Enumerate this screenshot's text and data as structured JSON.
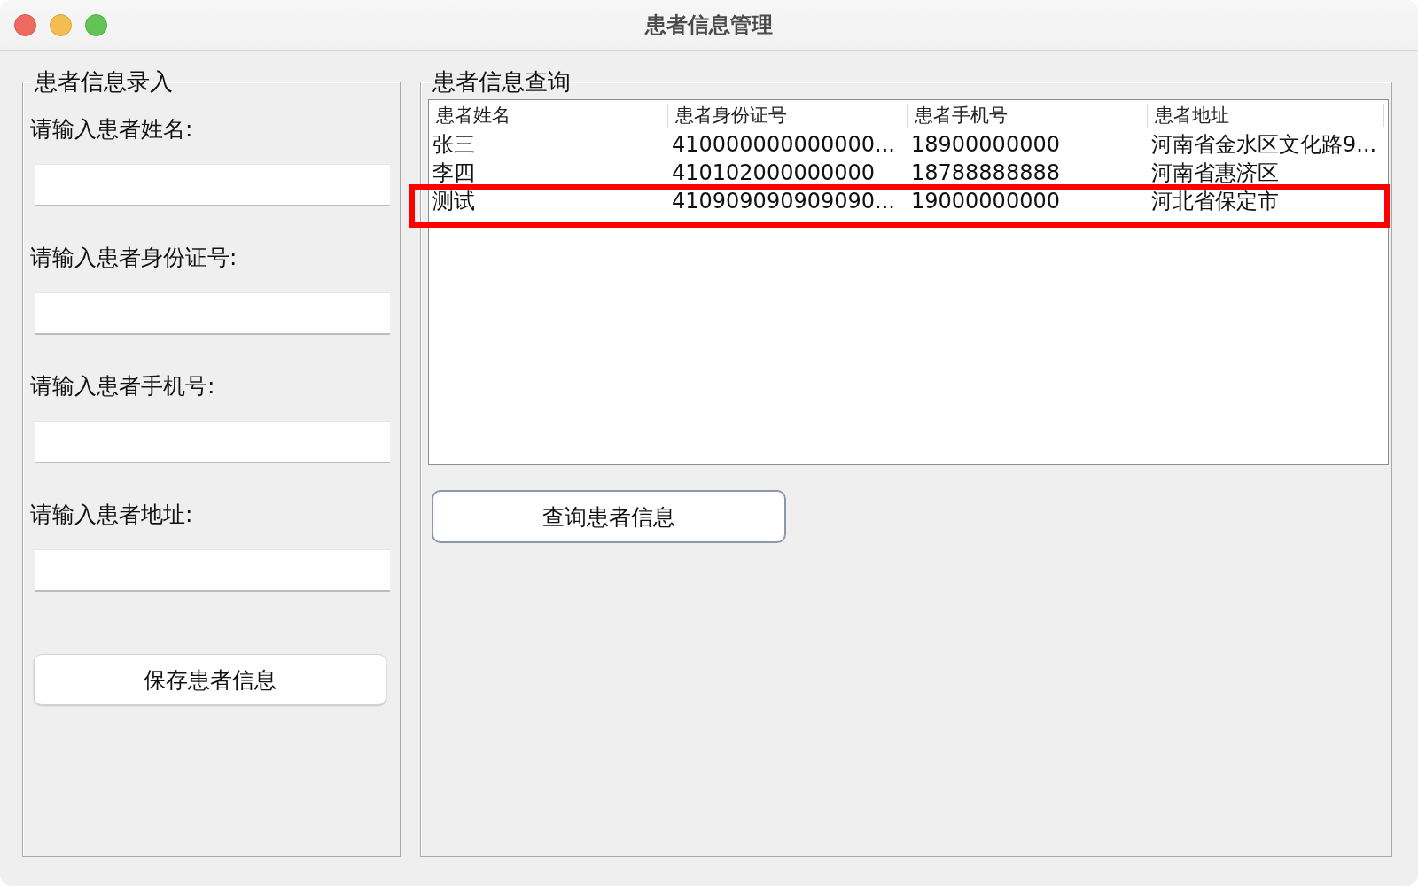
{
  "window": {
    "title": "患者信息管理"
  },
  "entry_panel": {
    "title": "患者信息录入",
    "fields": [
      {
        "label": "请输入患者姓名:"
      },
      {
        "label": "请输入患者身份证号:"
      },
      {
        "label": "请输入患者手机号:"
      },
      {
        "label": "请输入患者地址:"
      }
    ],
    "save_button": "保存患者信息"
  },
  "query_panel": {
    "title": "患者信息查询",
    "table": {
      "columns": [
        "患者姓名",
        "患者身份证号",
        "患者手机号",
        "患者地址"
      ],
      "rows": [
        {
          "cells": [
            "张三",
            "410000000000000...",
            "18900000000",
            "河南省金水区文化路9..."
          ],
          "highlighted": false
        },
        {
          "cells": [
            "李四",
            "410102000000000",
            "18788888888",
            "河南省惠济区"
          ],
          "highlighted": false
        },
        {
          "cells": [
            "测试",
            "410909090909090...",
            "19000000000",
            "河北省保定市"
          ],
          "highlighted": true
        }
      ]
    },
    "query_button": "查询患者信息"
  }
}
